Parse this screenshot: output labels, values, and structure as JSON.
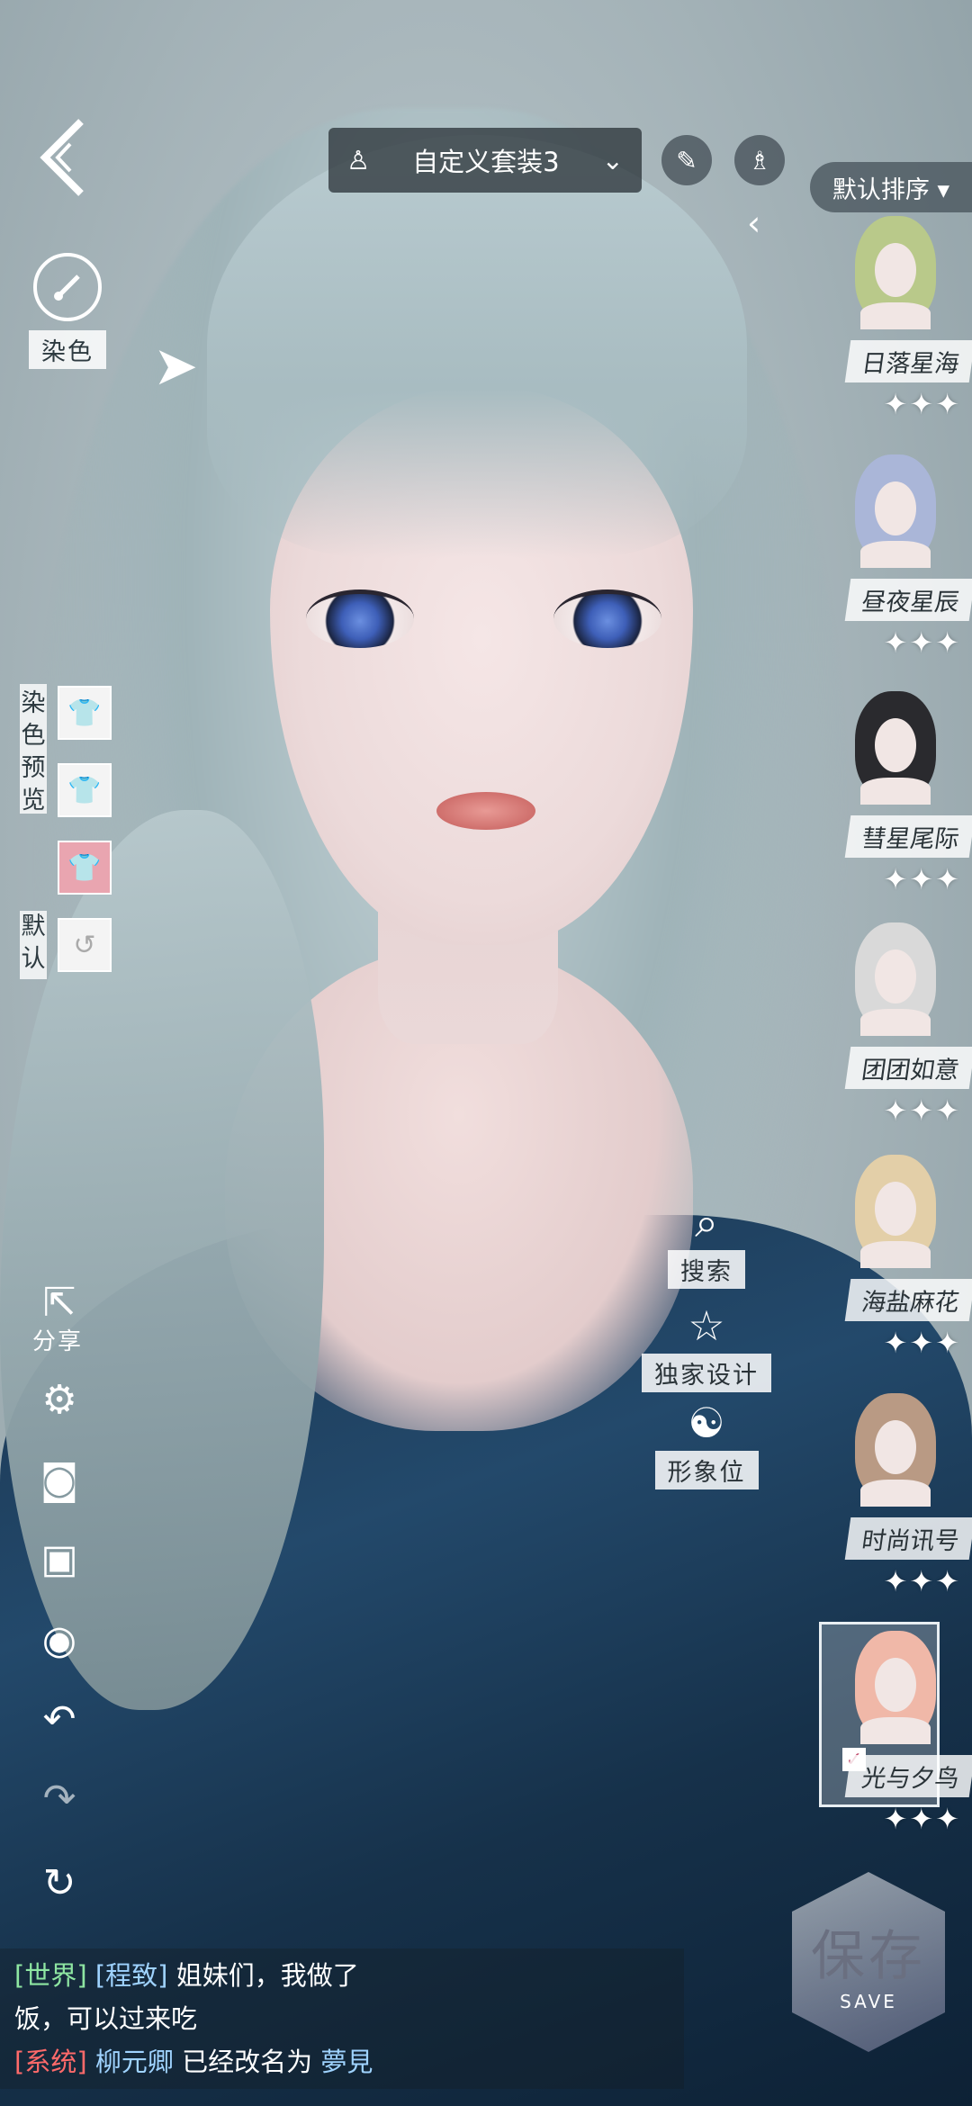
{
  "top_bar": {
    "outfit_name": "自定义套装3",
    "dropdown_icon": "chevron-down-icon",
    "brush_icon": "brush-icon",
    "dress_icon": "dress-icon"
  },
  "left_panel": {
    "dye_label": "染色",
    "dye_preview_label": "染色预览",
    "default_label": "默认",
    "share_label": "分享"
  },
  "sort": {
    "label": "默认排序 ▾"
  },
  "hair_list": [
    {
      "name": "日落星海",
      "stars": "✦✦✦",
      "color": "#b9c98a"
    },
    {
      "name": "昼夜星辰",
      "stars": "✦✦✦",
      "color": "#aab6d8"
    },
    {
      "name": "彗星尾际",
      "stars": "✦✦✦",
      "color": "#2a2a2e"
    },
    {
      "name": "团团如意",
      "stars": "✦✦✦",
      "color": "#d9d9d9"
    },
    {
      "name": "海盐麻花",
      "stars": "✦✦✦",
      "color": "#e3cfa8"
    },
    {
      "name": "时尚讯号",
      "stars": "✦✦✦",
      "color": "#b99a84"
    },
    {
      "name": "光与夕鸟",
      "stars": "✦✦✦",
      "color": "#f0b8a8",
      "selected": true
    }
  ],
  "center_actions": {
    "search": "搜索",
    "exclusive": "独家设计",
    "avatar": "形象位"
  },
  "save": {
    "label": "保存",
    "sub": "SAVE"
  },
  "chat": {
    "line1_channel": "[世界]",
    "line1_user": "[程致]",
    "line1_text": "姐妹们，我做了",
    "line2_text": "饭，可以过来吃",
    "line3_channel": "[系统]",
    "line3_name": "柳元卿",
    "line3_text": "已经改名为",
    "line3_newname": "夢見"
  }
}
